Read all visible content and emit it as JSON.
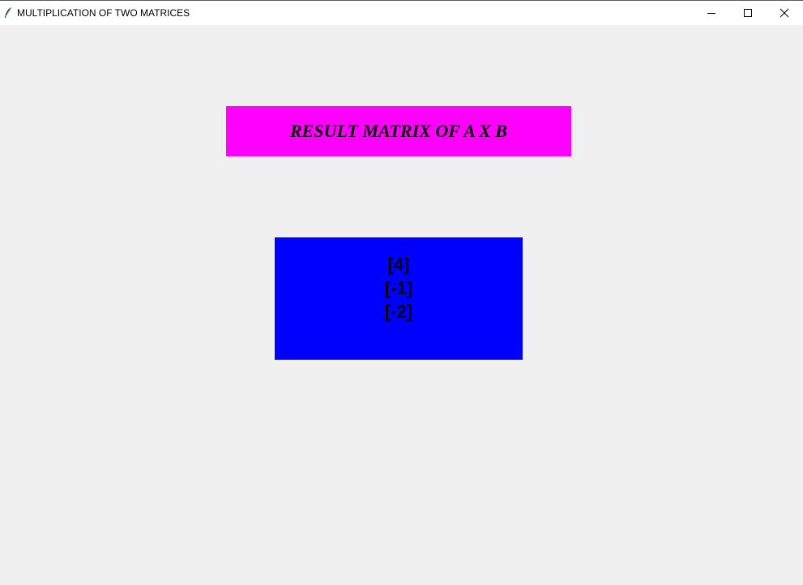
{
  "window": {
    "title": "MULTIPLICATION OF TWO MATRICES",
    "icon": "feather-icon",
    "controls": [
      "minimize-icon",
      "maximize-icon",
      "close-icon"
    ]
  },
  "heading": {
    "text": "RESULT MATRIX OF A X B",
    "background": "#ff00ff"
  },
  "result": {
    "background": "#0000ff",
    "rows": [
      "[4]",
      "[-1]",
      "[-2]"
    ]
  }
}
